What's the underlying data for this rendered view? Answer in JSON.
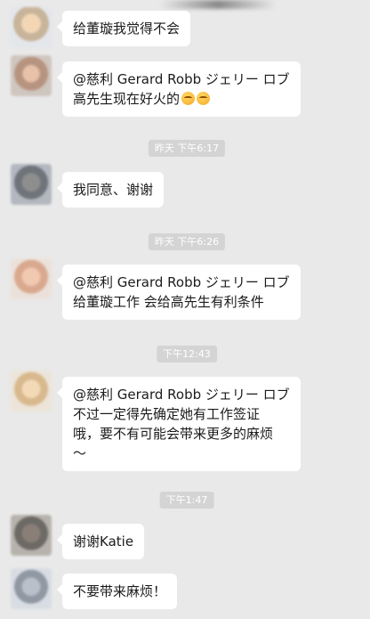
{
  "messages": [
    {
      "lines": [
        "给董璇我觉得不会"
      ]
    },
    {
      "lines": [
        "@慈利 Gerard Robb ジェリー ロブ",
        "高先生现在好火的"
      ],
      "emoji": [
        "grin-emoji",
        "grin-emoji"
      ]
    },
    {
      "lines": [
        "我同意、谢谢"
      ]
    },
    {
      "lines": [
        "@慈利 Gerard Robb ジェリー ロブ",
        "给董璇工作 会给高先生有利条件"
      ]
    },
    {
      "lines": [
        "@慈利 Gerard Robb ジェリー ロブ",
        " 不过一定得先确定她有工作签证",
        "哦，要不有可能会带来更多的麻烦",
        "～"
      ]
    },
    {
      "lines": [
        "谢谢Katie"
      ]
    },
    {
      "lines": [
        "不要带来麻烦！"
      ]
    }
  ],
  "timestamps": [
    "昨天 下午6:17",
    "昨天 下午6:26",
    "下午12:43",
    "下午1:47"
  ],
  "colors": {
    "background": "#e9e9e9",
    "bubble": "#ffffff",
    "timestamp_bg": "#d4d4d4",
    "text": "#1b1b1b"
  },
  "avatars": [
    "avatar-blurred-1",
    "avatar-blurred-2",
    "avatar-blurred-3",
    "avatar-blurred-4",
    "avatar-blurred-5",
    "avatar-blurred-6",
    "avatar-blurred-7"
  ]
}
